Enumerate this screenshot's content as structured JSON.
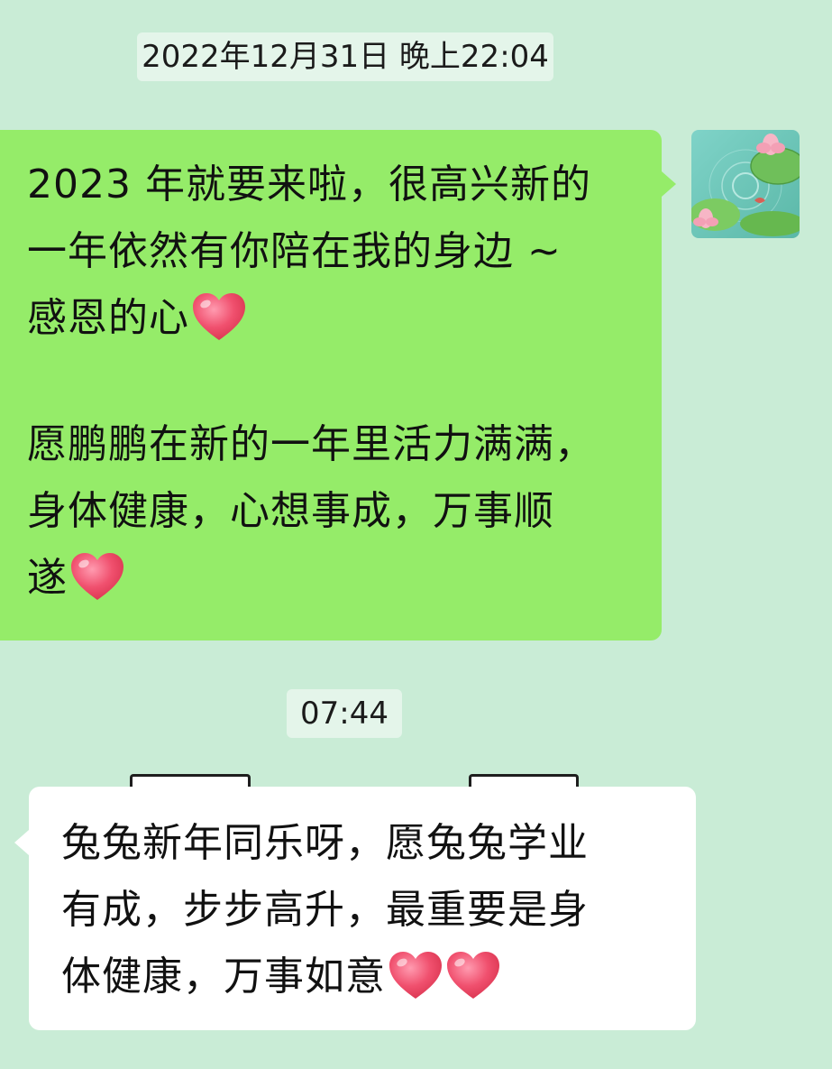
{
  "conversation": {
    "timestamp_1": "2022年12月31日 晚上22:04",
    "timestamp_2": "07:44",
    "sent_message": {
      "lines": [
        "2023 年就要来啦，很高兴新的",
        "一年依然有你陪在我的身边 ~",
        "感恩的心",
        "愿鹏鹏在新的一年里活力满满，",
        "身体健康，心想事成，万事顺",
        "遂"
      ],
      "emoji": "heart"
    },
    "received_message": {
      "lines": [
        "兔兔新年同乐呀，愿兔兔学业",
        "有成，步步高升，最重要是身",
        "体健康，万事如意"
      ],
      "emoji": "heart"
    }
  },
  "colors": {
    "background": "#c9ecd6",
    "sent_bubble": "#95ec69",
    "received_bubble": "#ffffff",
    "timestamp_bg": "#e4f5ea",
    "heart": "#f0506e"
  },
  "icons": {
    "avatar": "lotus-pond-avatar-icon",
    "emoji": "red-heart-emoji-icon"
  }
}
